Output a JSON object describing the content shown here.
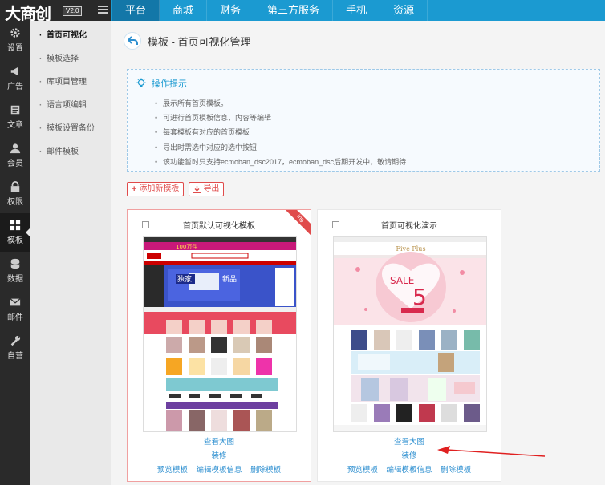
{
  "brand": {
    "logo": "大商创",
    "version": "V2.0"
  },
  "nav": {
    "items": [
      "平台",
      "商城",
      "财务",
      "第三方服务",
      "手机",
      "资源"
    ]
  },
  "iconbar": {
    "items": [
      {
        "label": "设置",
        "icon": "gear-icon"
      },
      {
        "label": "广告",
        "icon": "megaphone-icon"
      },
      {
        "label": "文章",
        "icon": "document-icon"
      },
      {
        "label": "会员",
        "icon": "user-icon"
      },
      {
        "label": "权限",
        "icon": "lock-icon"
      },
      {
        "label": "模板",
        "icon": "grid-icon"
      },
      {
        "label": "数据",
        "icon": "database-icon"
      },
      {
        "label": "邮件",
        "icon": "mail-icon"
      },
      {
        "label": "自营",
        "icon": "wrench-icon"
      }
    ]
  },
  "subbar": {
    "items": [
      "首页可视化",
      "模板选择",
      "库项目管理",
      "语言项编辑",
      "模板设置备份",
      "邮件模板"
    ]
  },
  "page": {
    "title": "模板 - 首页可视化管理"
  },
  "tips": {
    "title": "操作提示",
    "items": [
      "展示所有首页模板。",
      "可进行首页模板信息，内容等编辑",
      "每套模板有对应的首页模板",
      "导出时需选中对应的选中按钮",
      "该功能暂时只支持ecmoban_dsc2017，ecmoban_dsc后期开发中，敬请期待"
    ]
  },
  "actions": {
    "add": "添加新模板",
    "export": "导出"
  },
  "cards": [
    {
      "title": "首页默认可视化模板",
      "badge": "ing",
      "view": "查看大图",
      "decorate": "装修",
      "preview": "预览模板",
      "edit": "编辑模板信息",
      "delete": "删除模板",
      "shot": {
        "banner_left": "独家",
        "banner_right": "新品",
        "promo": "100万件"
      }
    },
    {
      "title": "首页可视化演示",
      "view": "查看大图",
      "decorate": "装修",
      "preview": "预览模板",
      "edit": "编辑模板信息",
      "delete": "删除模板",
      "shot": {
        "brand": "Five Plus",
        "sale": "SALE",
        "big_num": "5"
      }
    }
  ],
  "colors": {
    "accent": "#1b9ad1",
    "danger": "#e04b4b",
    "link": "#2d8fd0"
  }
}
